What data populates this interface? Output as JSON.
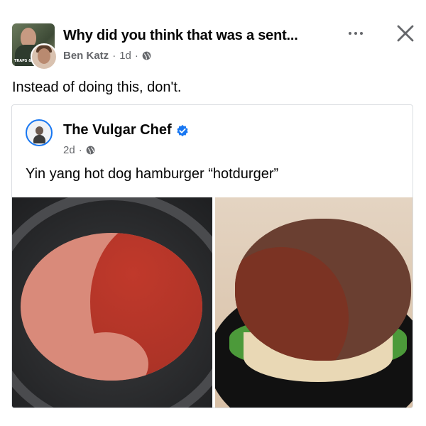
{
  "post": {
    "title": "Why did you think that was a sent...",
    "author": "Ben Katz",
    "time": "1d",
    "separator": "·",
    "caption": "Instead of doing this, don't.",
    "group_avatar_caption": "TRAPS & A"
  },
  "shared_post": {
    "author": "The Vulgar Chef",
    "time": "2d",
    "separator": "·",
    "text": "Yin yang hot dog hamburger “hotdurger”",
    "verified": true
  },
  "colors": {
    "text": "#050505",
    "meta": "#65676b",
    "verified": "#1877f2",
    "border": "#dadde1"
  },
  "icons": {
    "more": "more-horizontal-icon",
    "close": "close-icon",
    "audience": "globe-icon",
    "verified": "verified-badge-icon"
  }
}
